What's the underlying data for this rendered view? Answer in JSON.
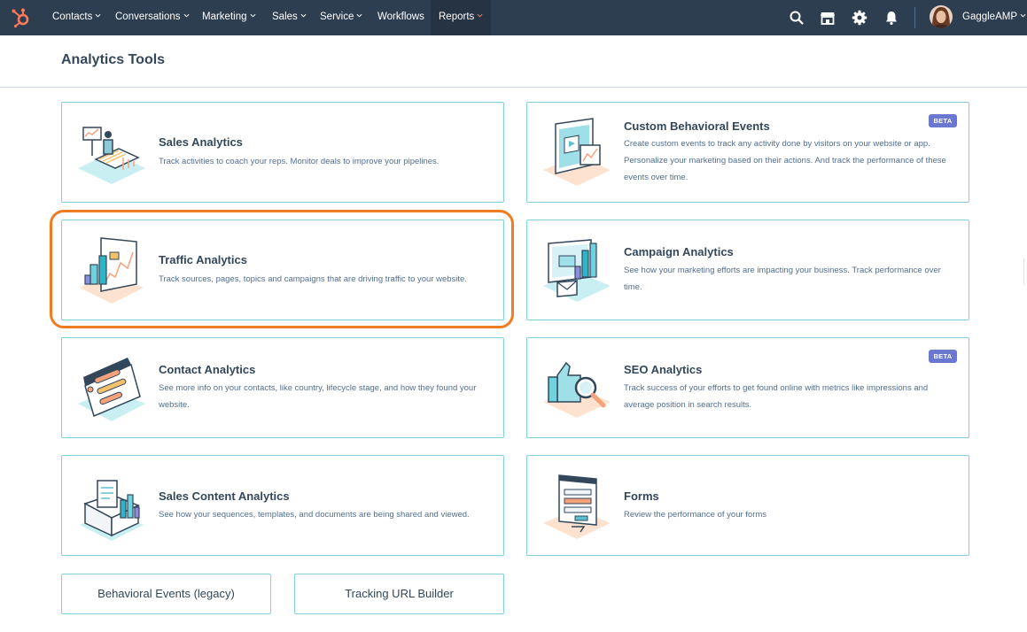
{
  "nav": {
    "items": [
      {
        "label": "Contacts"
      },
      {
        "label": "Conversations"
      },
      {
        "label": "Marketing"
      },
      {
        "label": "Sales"
      },
      {
        "label": "Service"
      },
      {
        "label": "Workflows"
      },
      {
        "label": "Reports"
      }
    ],
    "account_name": "GaggleAMP",
    "icons": [
      "search-icon",
      "marketplace-icon",
      "settings-icon",
      "notifications-icon"
    ],
    "colors": {
      "bar": "#2d3e50",
      "accent": "#ff7a59"
    }
  },
  "page": {
    "title": "Analytics Tools"
  },
  "cards": [
    {
      "title": "Sales Analytics",
      "description": "Track activities to coach your reps. Monitor deals to improve your pipelines."
    },
    {
      "title": "Custom Behavioral Events",
      "description": "Create custom events to track any activity done by visitors on your website or app. Personalize your marketing based on their actions. And track the performance of these events over time.",
      "badge": "BETA"
    },
    {
      "title": "Traffic Analytics",
      "description": "Track sources, pages, topics and campaigns that are driving traffic to your website."
    },
    {
      "title": "Campaign Analytics",
      "description": "See how your marketing efforts are impacting your business. Track performance over time."
    },
    {
      "title": "Contact Analytics",
      "description": "See more info on your contacts, like country, lifecycle stage, and how they found your website."
    },
    {
      "title": "SEO Analytics",
      "description": "Track success of your efforts to get found online with metrics like impressions and average position in search results.",
      "badge": "BETA"
    },
    {
      "title": "Sales Content Analytics",
      "description": "See how your sequences, templates, and documents are being shared and viewed."
    },
    {
      "title": "Forms",
      "description": "Review the performance of your forms"
    }
  ],
  "links": [
    {
      "label": "Behavioral Events (legacy)"
    },
    {
      "label": "Tracking URL Builder"
    }
  ]
}
